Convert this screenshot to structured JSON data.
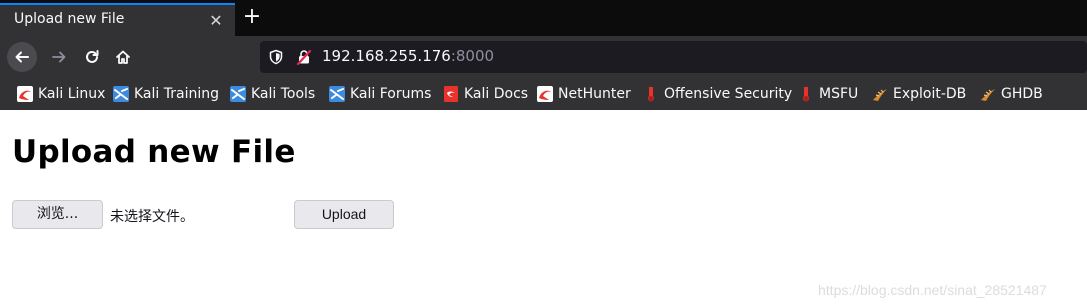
{
  "tab": {
    "title": "Upload new File",
    "close_glyph": "✕",
    "new_tab_glyph": "+"
  },
  "nav": {
    "url_host": "192.168.255.176",
    "url_port": ":8000",
    "icons": [
      "back-arrow-icon",
      "forward-arrow-icon",
      "reload-icon",
      "home-icon",
      "tracking-shield-icon",
      "insecure-lock-icon"
    ]
  },
  "bookmarks": [
    {
      "label": "Kali Linux",
      "icon": "kali-dragon-icon"
    },
    {
      "label": "Kali Training",
      "icon": "kali-training-icon"
    },
    {
      "label": "Kali Tools",
      "icon": "kali-tools-icon"
    },
    {
      "label": "Kali Forums",
      "icon": "kali-forums-icon"
    },
    {
      "label": "Kali Docs",
      "icon": "kali-docs-icon"
    },
    {
      "label": "NetHunter",
      "icon": "nethunter-icon"
    },
    {
      "label": "Offensive Security",
      "icon": "offsec-icon"
    },
    {
      "label": "MSFU",
      "icon": "msfu-icon"
    },
    {
      "label": "Exploit-DB",
      "icon": "exploit-db-icon"
    },
    {
      "label": "GHDB",
      "icon": "ghdb-icon"
    }
  ],
  "page": {
    "heading": "Upload new File",
    "browse_label": "浏览...",
    "file_status": "未选择文件。",
    "upload_label": "Upload"
  },
  "watermark": "https://blog.csdn.net/sinat_28521487",
  "colors": {
    "tab_accent": "#0a84ff",
    "chrome_bg": "#323234",
    "tabstrip_bg": "#0c0c0d",
    "url_bg": "#1c1b22",
    "kali_red": "#e8332d",
    "kali_blue": "#3c8be0",
    "exploit_orange": "#d98b2b"
  }
}
